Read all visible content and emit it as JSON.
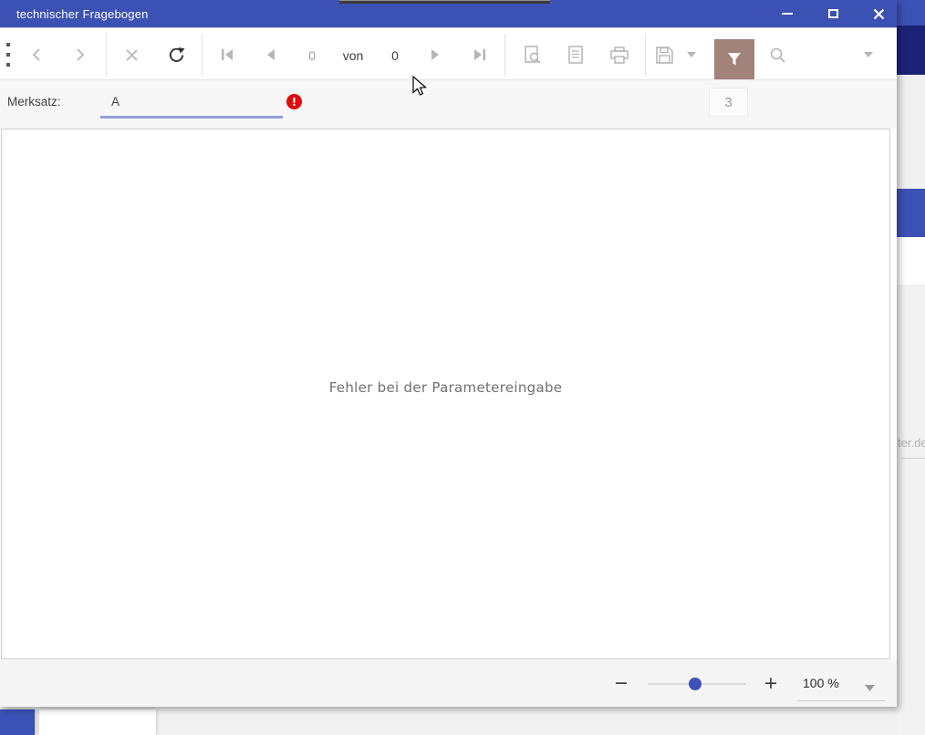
{
  "window": {
    "title": "technischer Fragebogen",
    "controls": [
      "minimize",
      "maximize",
      "close"
    ]
  },
  "toolbar": {
    "page_current": "0",
    "page_of_label": "von",
    "page_total": "0",
    "icons": [
      "grip-icon",
      "back-icon",
      "forward-icon",
      "cancel-icon",
      "refresh-icon",
      "first-page-icon",
      "previous-page-icon",
      "next-page-icon",
      "last-page-icon",
      "print-preview-icon",
      "page-setup-icon",
      "print-icon",
      "save-export-icon",
      "save-dropdown-icon",
      "filter-icon",
      "search-icon",
      "search-dropdown-icon"
    ],
    "filter_active": true
  },
  "parameters": {
    "label": "Merksatz:",
    "value": "A",
    "error_icon": "validation-error-icon",
    "badge": "3"
  },
  "report": {
    "message": "Fehler bei der Parametereingabe"
  },
  "statusbar": {
    "zoom_level": "100 %",
    "zoom_slider_position": 0.48
  },
  "background_window": {
    "partial_text": "ter.de"
  },
  "colors": {
    "titlebar_blue": "#3c51b4",
    "dark_navy": "#1c2376",
    "band_blue": "#3b51b5",
    "filter_button_brown": "#a2837b",
    "error_red": "#e00b0b",
    "input_underline": "#93a0da",
    "slider_thumb": "#3f51b5"
  }
}
